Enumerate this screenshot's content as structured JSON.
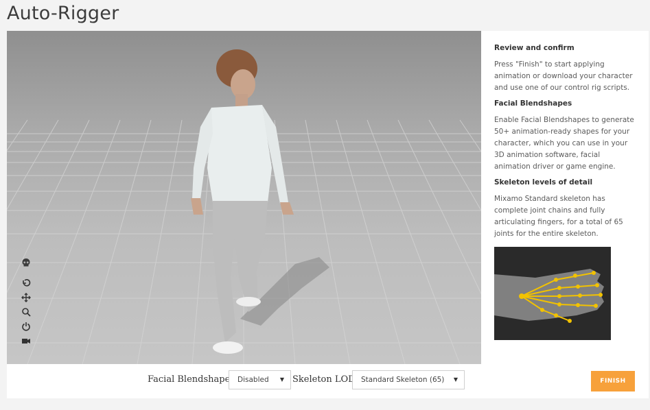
{
  "page": {
    "title": "Auto-Rigger"
  },
  "viewport": {
    "tools": [
      {
        "name": "skull-icon"
      },
      {
        "name": "rotate-icon"
      },
      {
        "name": "move-icon"
      },
      {
        "name": "zoom-icon"
      },
      {
        "name": "power-icon"
      },
      {
        "name": "camera-icon"
      }
    ]
  },
  "info": {
    "review_heading": "Review and confirm",
    "review_text": "Press \"Finish\" to start applying animation or download your character and use one of our control rig scripts.",
    "blendshapes_heading": "Facial Blendshapes",
    "blendshapes_text": "Enable Facial Blendshapes to generate 50+ animation-ready shapes for your character, which you can use in your 3D animation software, facial animation driver or game engine.",
    "skeleton_heading": "Skeleton levels of detail",
    "skeleton_text": "Mixamo Standard skeleton has complete joint chains and fully articulating fingers, for a total of 65 joints for the entire skeleton."
  },
  "controls": {
    "blendshapes_label": "Facial Blendshapes",
    "blendshapes_value": "Disabled",
    "lod_label": "Skeleton LOD",
    "lod_value": "Standard Skeleton (65)",
    "finish_label": "FINISH"
  },
  "colors": {
    "accent": "#f7a13b",
    "page_bg": "#f3f3f3",
    "viewport_floor": "#bcbcbc"
  }
}
